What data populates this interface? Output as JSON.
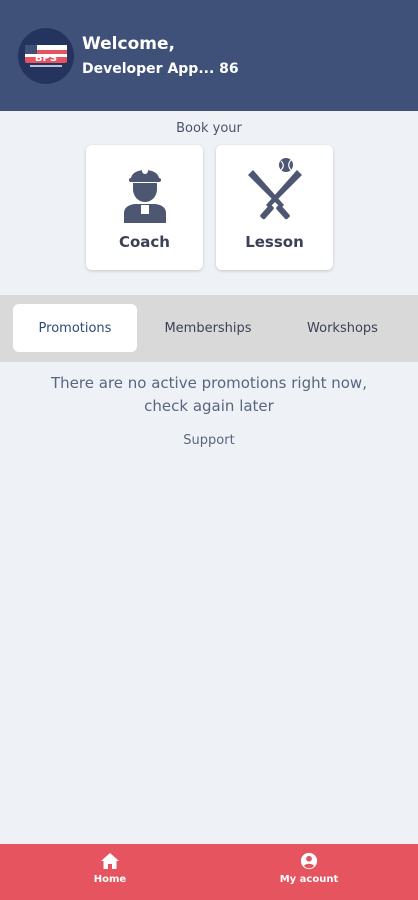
{
  "header": {
    "welcome": "Welcome,",
    "username": "Developer App... 86",
    "logo_text": "BPS",
    "colors": {
      "background": "#3f5179",
      "avatar": "#24345f"
    }
  },
  "book": {
    "label": "Book your",
    "cards": [
      {
        "label": "Coach",
        "icon": "coach-icon"
      },
      {
        "label": "Lesson",
        "icon": "baseball-bats-icon"
      }
    ]
  },
  "tabs": [
    {
      "label": "Promotions",
      "active": true
    },
    {
      "label": "Memberships",
      "active": false
    },
    {
      "label": "Workshops",
      "active": false
    }
  ],
  "promotions": {
    "empty_message": "There are no active promotions right now, check again later",
    "support_label": "Support"
  },
  "bottom_nav": {
    "items": [
      {
        "label": "Home",
        "icon": "home-icon"
      },
      {
        "label": "My acount",
        "icon": "account-icon"
      }
    ],
    "color": "#e5545f"
  }
}
